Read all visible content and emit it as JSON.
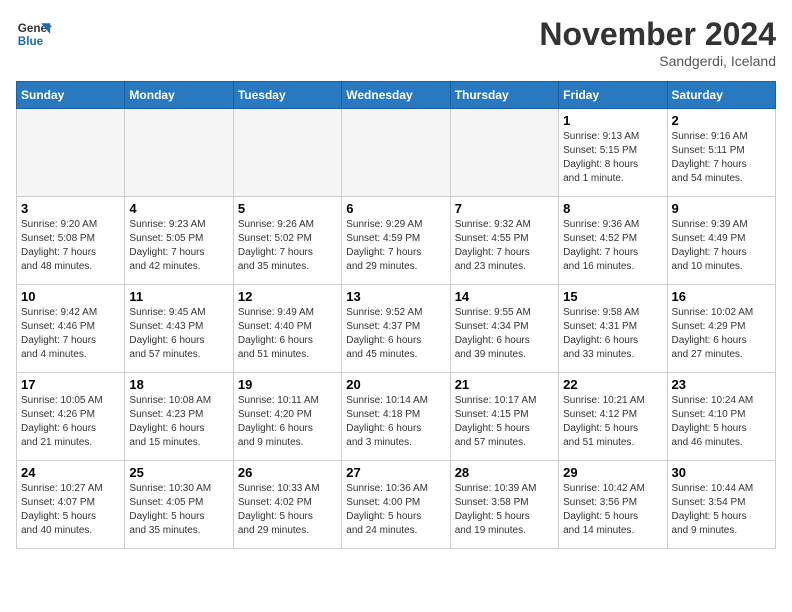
{
  "header": {
    "logo_line1": "General",
    "logo_line2": "Blue",
    "month_title": "November 2024",
    "subtitle": "Sandgerdi, Iceland"
  },
  "weekdays": [
    "Sunday",
    "Monday",
    "Tuesday",
    "Wednesday",
    "Thursday",
    "Friday",
    "Saturday"
  ],
  "weeks": [
    [
      {
        "day": "",
        "info": "",
        "empty": true
      },
      {
        "day": "",
        "info": "",
        "empty": true
      },
      {
        "day": "",
        "info": "",
        "empty": true
      },
      {
        "day": "",
        "info": "",
        "empty": true
      },
      {
        "day": "",
        "info": "",
        "empty": true
      },
      {
        "day": "1",
        "info": "Sunrise: 9:13 AM\nSunset: 5:15 PM\nDaylight: 8 hours\nand 1 minute."
      },
      {
        "day": "2",
        "info": "Sunrise: 9:16 AM\nSunset: 5:11 PM\nDaylight: 7 hours\nand 54 minutes."
      }
    ],
    [
      {
        "day": "3",
        "info": "Sunrise: 9:20 AM\nSunset: 5:08 PM\nDaylight: 7 hours\nand 48 minutes."
      },
      {
        "day": "4",
        "info": "Sunrise: 9:23 AM\nSunset: 5:05 PM\nDaylight: 7 hours\nand 42 minutes."
      },
      {
        "day": "5",
        "info": "Sunrise: 9:26 AM\nSunset: 5:02 PM\nDaylight: 7 hours\nand 35 minutes."
      },
      {
        "day": "6",
        "info": "Sunrise: 9:29 AM\nSunset: 4:59 PM\nDaylight: 7 hours\nand 29 minutes."
      },
      {
        "day": "7",
        "info": "Sunrise: 9:32 AM\nSunset: 4:55 PM\nDaylight: 7 hours\nand 23 minutes."
      },
      {
        "day": "8",
        "info": "Sunrise: 9:36 AM\nSunset: 4:52 PM\nDaylight: 7 hours\nand 16 minutes."
      },
      {
        "day": "9",
        "info": "Sunrise: 9:39 AM\nSunset: 4:49 PM\nDaylight: 7 hours\nand 10 minutes."
      }
    ],
    [
      {
        "day": "10",
        "info": "Sunrise: 9:42 AM\nSunset: 4:46 PM\nDaylight: 7 hours\nand 4 minutes."
      },
      {
        "day": "11",
        "info": "Sunrise: 9:45 AM\nSunset: 4:43 PM\nDaylight: 6 hours\nand 57 minutes."
      },
      {
        "day": "12",
        "info": "Sunrise: 9:49 AM\nSunset: 4:40 PM\nDaylight: 6 hours\nand 51 minutes."
      },
      {
        "day": "13",
        "info": "Sunrise: 9:52 AM\nSunset: 4:37 PM\nDaylight: 6 hours\nand 45 minutes."
      },
      {
        "day": "14",
        "info": "Sunrise: 9:55 AM\nSunset: 4:34 PM\nDaylight: 6 hours\nand 39 minutes."
      },
      {
        "day": "15",
        "info": "Sunrise: 9:58 AM\nSunset: 4:31 PM\nDaylight: 6 hours\nand 33 minutes."
      },
      {
        "day": "16",
        "info": "Sunrise: 10:02 AM\nSunset: 4:29 PM\nDaylight: 6 hours\nand 27 minutes."
      }
    ],
    [
      {
        "day": "17",
        "info": "Sunrise: 10:05 AM\nSunset: 4:26 PM\nDaylight: 6 hours\nand 21 minutes."
      },
      {
        "day": "18",
        "info": "Sunrise: 10:08 AM\nSunset: 4:23 PM\nDaylight: 6 hours\nand 15 minutes."
      },
      {
        "day": "19",
        "info": "Sunrise: 10:11 AM\nSunset: 4:20 PM\nDaylight: 6 hours\nand 9 minutes."
      },
      {
        "day": "20",
        "info": "Sunrise: 10:14 AM\nSunset: 4:18 PM\nDaylight: 6 hours\nand 3 minutes."
      },
      {
        "day": "21",
        "info": "Sunrise: 10:17 AM\nSunset: 4:15 PM\nDaylight: 5 hours\nand 57 minutes."
      },
      {
        "day": "22",
        "info": "Sunrise: 10:21 AM\nSunset: 4:12 PM\nDaylight: 5 hours\nand 51 minutes."
      },
      {
        "day": "23",
        "info": "Sunrise: 10:24 AM\nSunset: 4:10 PM\nDaylight: 5 hours\nand 46 minutes."
      }
    ],
    [
      {
        "day": "24",
        "info": "Sunrise: 10:27 AM\nSunset: 4:07 PM\nDaylight: 5 hours\nand 40 minutes."
      },
      {
        "day": "25",
        "info": "Sunrise: 10:30 AM\nSunset: 4:05 PM\nDaylight: 5 hours\nand 35 minutes."
      },
      {
        "day": "26",
        "info": "Sunrise: 10:33 AM\nSunset: 4:02 PM\nDaylight: 5 hours\nand 29 minutes."
      },
      {
        "day": "27",
        "info": "Sunrise: 10:36 AM\nSunset: 4:00 PM\nDaylight: 5 hours\nand 24 minutes."
      },
      {
        "day": "28",
        "info": "Sunrise: 10:39 AM\nSunset: 3:58 PM\nDaylight: 5 hours\nand 19 minutes."
      },
      {
        "day": "29",
        "info": "Sunrise: 10:42 AM\nSunset: 3:56 PM\nDaylight: 5 hours\nand 14 minutes."
      },
      {
        "day": "30",
        "info": "Sunrise: 10:44 AM\nSunset: 3:54 PM\nDaylight: 5 hours\nand 9 minutes."
      }
    ]
  ]
}
